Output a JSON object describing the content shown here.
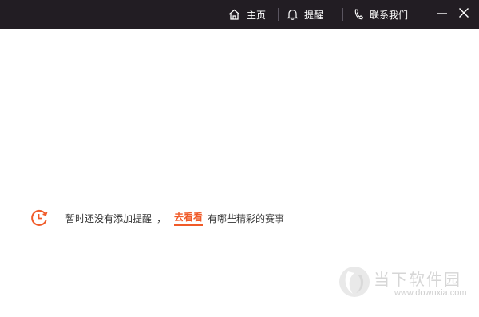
{
  "titlebar": {
    "home_label": "主页",
    "remind_label": "提醒",
    "contact_label": "联系我们",
    "icons": {
      "home": "home-icon",
      "remind": "bell-icon",
      "contact": "phone-icon",
      "minimize": "minimize-icon",
      "close": "close-icon"
    },
    "background_color": "#221d23"
  },
  "empty_state": {
    "message": "暂时还没有添加提醒",
    "separator": "，",
    "link_label": "去看看",
    "suffix": "有哪些精彩的赛事",
    "icon": "clock-icon",
    "accent_color": "#f05a28"
  },
  "watermark": {
    "text": "当下软件园",
    "url": "www.downxia.com"
  }
}
